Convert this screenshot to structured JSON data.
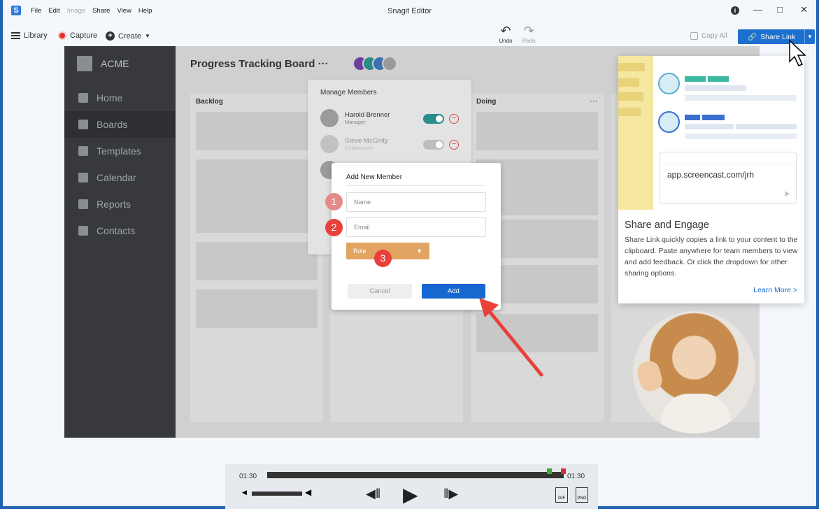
{
  "window": {
    "title": "Snagit Editor",
    "logo": "S",
    "info": "i"
  },
  "menu": [
    "File",
    "Edit",
    "Image",
    "Share",
    "View",
    "Help"
  ],
  "toolbar": {
    "library": "Library",
    "capture": "Capture",
    "create": "Create",
    "undo": "Undo",
    "redo": "Redo",
    "copy_all": "Copy All",
    "share_link": "Share Link"
  },
  "app": {
    "brand": "ACME",
    "nav": [
      "Home",
      "Boards",
      "Templates",
      "Calendar",
      "Reports",
      "Contacts"
    ],
    "board_title": "Progress Tracking Board",
    "board_more": "···",
    "columns": [
      {
        "title": "Backlog"
      },
      {
        "title": "Doing",
        "more": "···"
      }
    ],
    "manage": {
      "title": "Manage Members",
      "members": [
        {
          "name": "Harold Brenner",
          "role": "Manager"
        },
        {
          "name": "Steve McGinty",
          "role": "Collaborator"
        }
      ]
    },
    "dialog": {
      "title": "Add New Member",
      "name_placeholder": "Name",
      "email_placeholder": "Email",
      "role_label": "Role",
      "cancel": "Cancel",
      "add": "Add"
    },
    "steps": [
      "1",
      "2",
      "3"
    ]
  },
  "popup": {
    "url": "app.screencast.com/jrh",
    "title": "Share and Engage",
    "body": "Share Link quickly copies a link to your content to the clipboard. Paste anywhere for team members to view and add feedback. Or click the dropdown for other sharing options.",
    "learn_more": "Learn More >"
  },
  "player": {
    "time_left": "01:30",
    "time_right": "01:30",
    "gif": "GIF",
    "png": "PNG"
  },
  "colors": {
    "accent": "#1d6fd0",
    "arrow": "#e8413c"
  }
}
